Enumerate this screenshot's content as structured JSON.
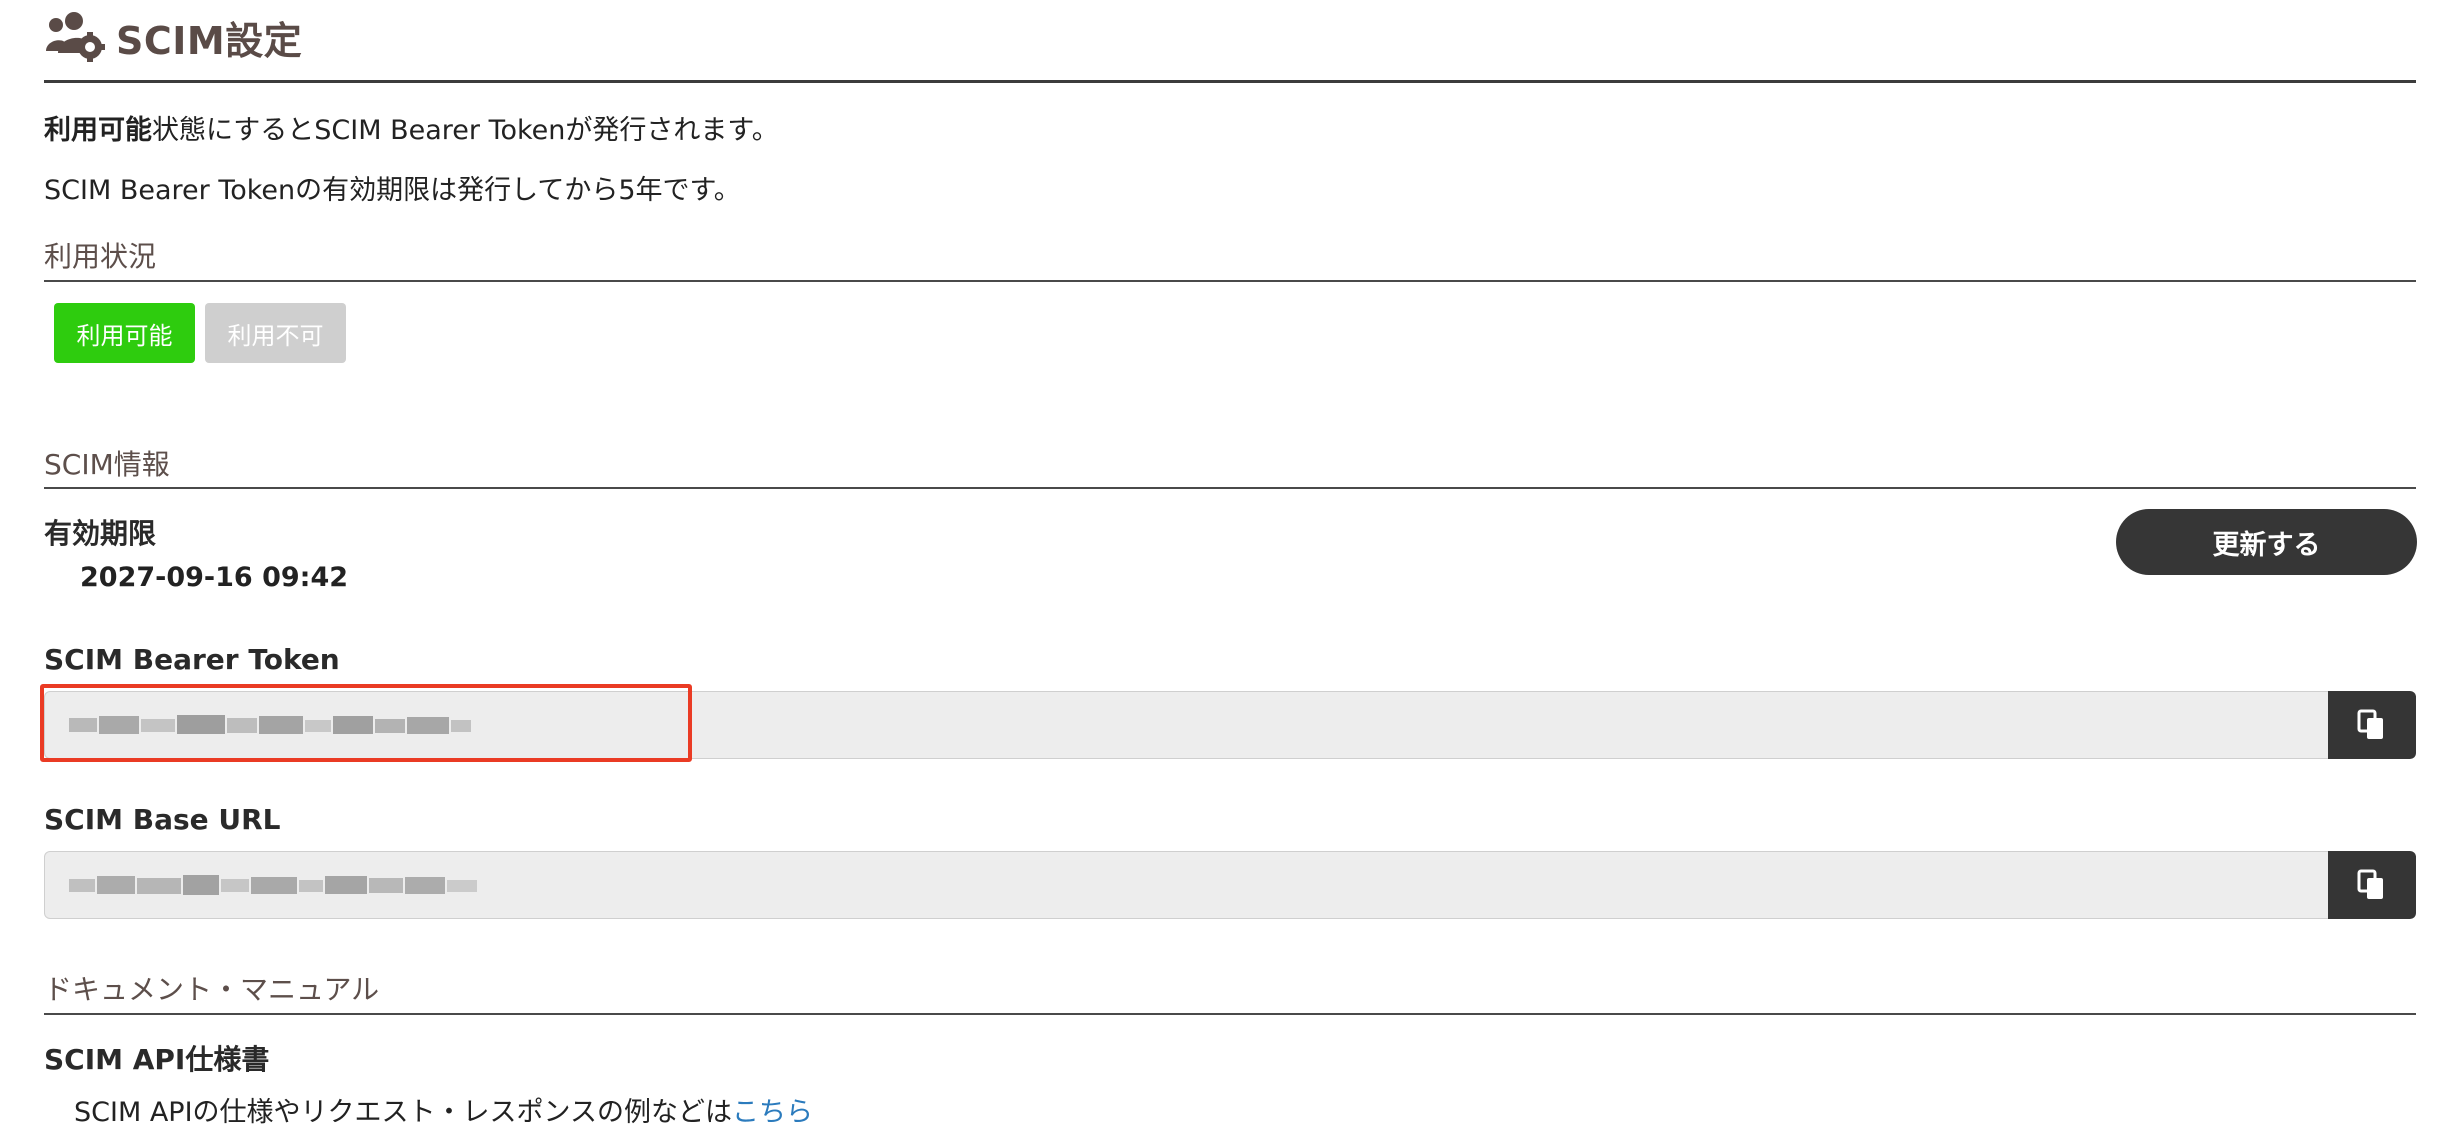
{
  "header": {
    "icon": "users-gear-icon",
    "title": "SCIM設定"
  },
  "description": {
    "line1_bold": "利用可能",
    "line1_rest": "状態にするとSCIM Bearer Tokenが発行されます。",
    "line2": "SCIM Bearer Tokenの有効期限は発行してから5年です。"
  },
  "availability": {
    "heading": "利用状況",
    "enabled_label": "利用可能",
    "disabled_label": "利用不可",
    "enabled_color": "#2ecc0e",
    "disabled_color": "#cfcfcf"
  },
  "scim_info": {
    "heading": "SCIM情報",
    "expiry_label": "有効期限",
    "expiry_value": "2027-09-16 09:42",
    "renew_label": "更新する",
    "token_label": "SCIM Bearer Token",
    "base_url_label": "SCIM Base URL",
    "copy_icon": "copy-icon"
  },
  "docs": {
    "heading": "ドキュメント・マニュアル",
    "api_spec_label": "SCIM API仕様書",
    "api_spec_text": "SCIM APIの仕様やリクエスト・レスポンスの例などは",
    "api_spec_link": "こちら"
  },
  "colors": {
    "title": "#5a4b47",
    "highlight": "#ea3b24",
    "link": "#2b7bbd",
    "dark_button": "#363636"
  }
}
